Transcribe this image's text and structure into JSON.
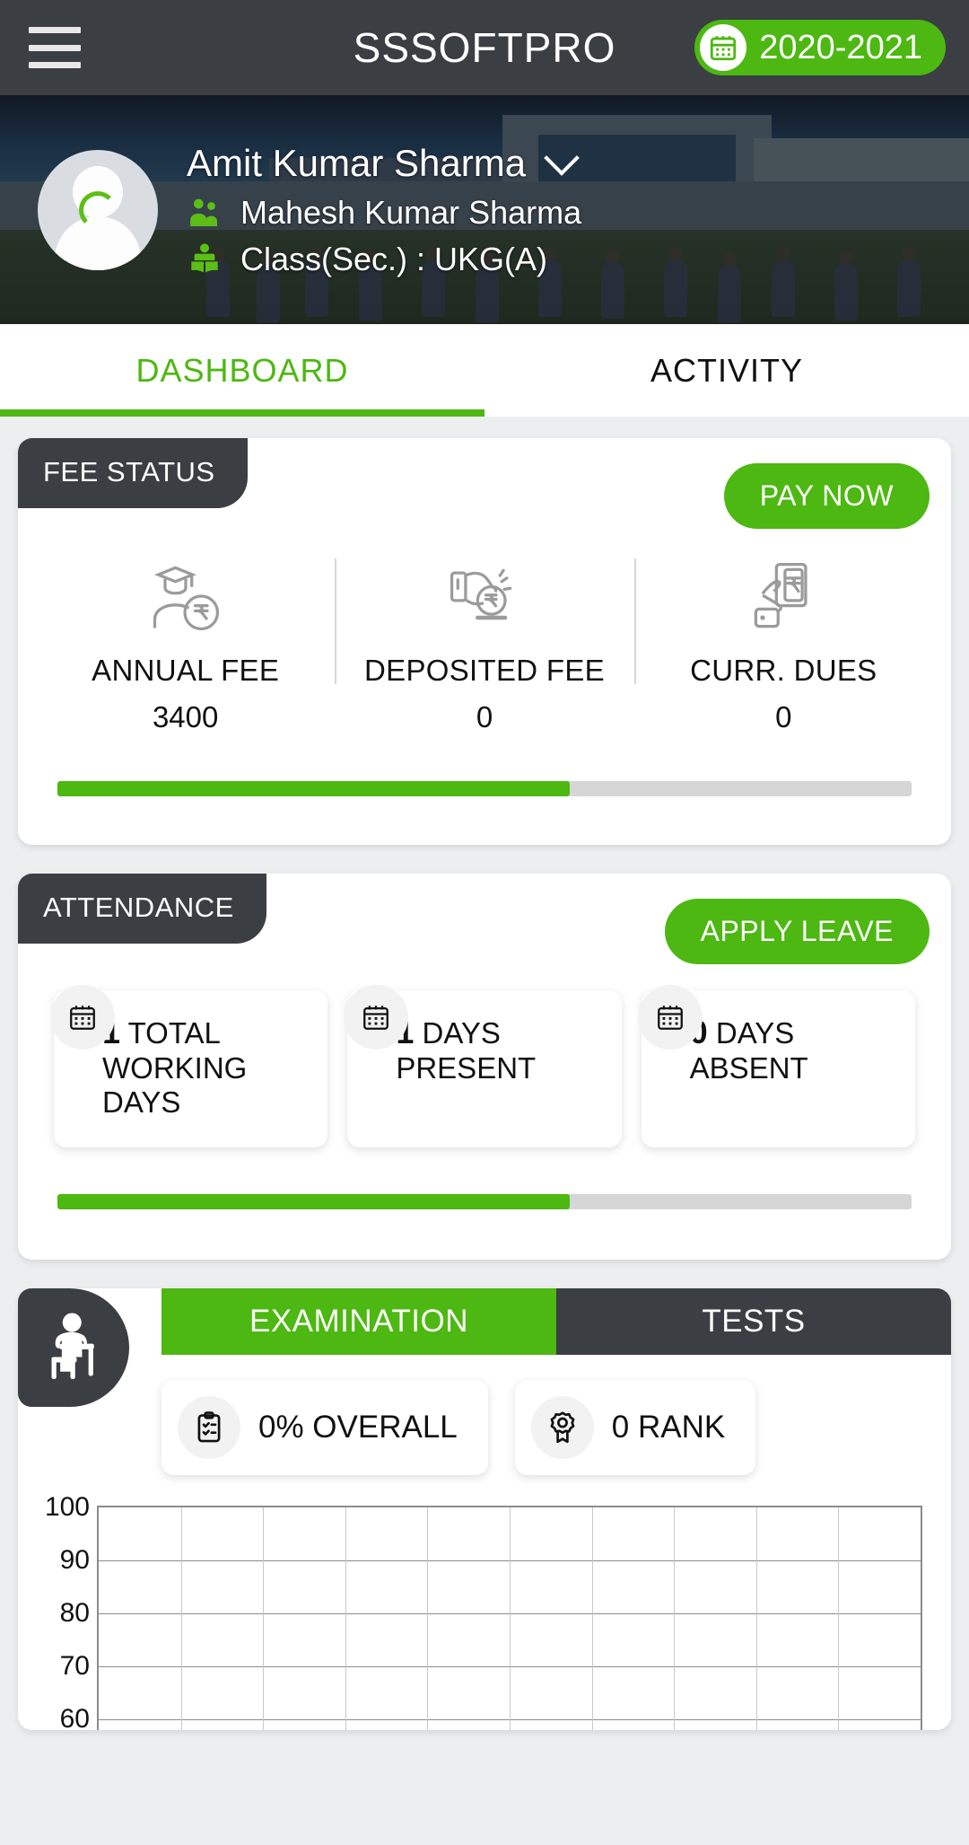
{
  "topbar": {
    "menu_icon": "hamburger-icon",
    "title": "SSSOFTPRO",
    "session_icon": "calendar-icon",
    "session": "2020-2021"
  },
  "profile": {
    "avatar_icon": "user-avatar-placeholder",
    "student_name": "Amit Kumar Sharma",
    "dropdown_icon": "chevron-down-icon",
    "guardian_icon": "parents-icon",
    "guardian_name": "Mahesh Kumar Sharma",
    "class_icon": "student-book-icon",
    "class_label": "Class(Sec.) : UKG(A)"
  },
  "tabs": [
    {
      "label": "DASHBOARD",
      "active": true
    },
    {
      "label": "ACTIVITY",
      "active": false
    }
  ],
  "fee_status": {
    "tag": "FEE STATUS",
    "action": "PAY NOW",
    "stats": [
      {
        "icon": "graduate-rupee-icon",
        "label": "ANNUAL FEE",
        "value": "3400"
      },
      {
        "icon": "hand-coin-icon",
        "label": "DEPOSITED FEE",
        "value": "0"
      },
      {
        "icon": "mobile-payment-icon",
        "label": "CURR. DUES",
        "value": "0"
      }
    ],
    "progress_percent": 60
  },
  "attendance": {
    "tag": "ATTENDANCE",
    "action": "APPLY LEAVE",
    "boxes": [
      {
        "icon": "calendar-icon",
        "number": "1",
        "label": "TOTAL WORKING DAYS"
      },
      {
        "icon": "calendar-icon",
        "number": "1",
        "label": "DAYS PRESENT"
      },
      {
        "icon": "calendar-icon",
        "number": "0",
        "label": "DAYS ABSENT"
      }
    ],
    "progress_percent": 60
  },
  "examination": {
    "avatar_icon": "student-at-desk-icon",
    "tabs": [
      {
        "label": "EXAMINATION",
        "active": true
      },
      {
        "label": "TESTS",
        "active": false
      }
    ],
    "pills": [
      {
        "icon": "clipboard-check-icon",
        "text": "0% OVERALL"
      },
      {
        "icon": "award-medal-icon",
        "text": "0 RANK"
      }
    ]
  },
  "chart_data": {
    "type": "line",
    "title": "",
    "xlabel": "",
    "ylabel": "",
    "categories": [],
    "series": [],
    "values": [],
    "ylim": [
      0,
      100
    ],
    "y_ticks": [
      "100",
      "90",
      "80",
      "70",
      "60"
    ],
    "y_ticks_visible": [
      "100",
      "90",
      "80",
      "70",
      "60"
    ],
    "grid": true,
    "x_gridline_count": 10,
    "legend": "none",
    "note": "empty plot area, no plotted data visible"
  },
  "colors": {
    "accent_green": "#4cb811",
    "dark": "#3b3e42",
    "page_bg": "#eceef0",
    "card_bg": "#ffffff",
    "track_gray": "#d6d6d6"
  }
}
